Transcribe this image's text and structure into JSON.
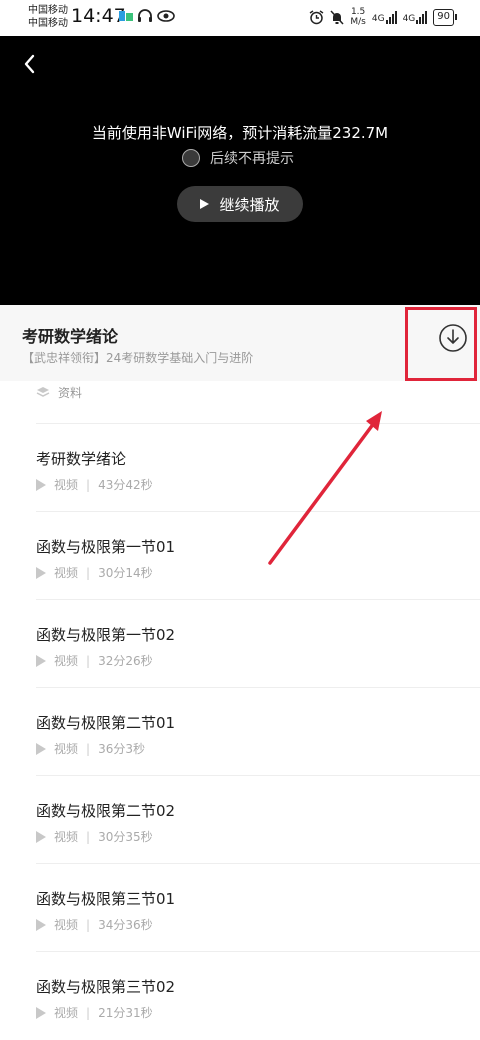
{
  "status_bar": {
    "carrier_1": "中国移动",
    "carrier_2": "中国移动",
    "time": "14:47",
    "speed_value": "1.5",
    "speed_unit": "M/s",
    "net_type_1": "4G",
    "net_type_2": "4G",
    "battery": "90"
  },
  "player": {
    "network_warning": "当前使用非WiFi网络，预计消耗流量232.7M",
    "no_remind_label": "后续不再提示",
    "continue_label": "继续播放"
  },
  "course": {
    "title": "考研数学绪论",
    "subtitle": "【武忠祥领衔】24考研数学基础入门与进阶"
  },
  "materials_label": "资料",
  "lessons": [
    {
      "title": "考研数学绪论",
      "type": "视频",
      "duration": "43分42秒"
    },
    {
      "title": "函数与极限第一节01",
      "type": "视频",
      "duration": "30分14秒"
    },
    {
      "title": "函数与极限第一节02",
      "type": "视频",
      "duration": "32分26秒"
    },
    {
      "title": "函数与极限第二节01",
      "type": "视频",
      "duration": "36分3秒"
    },
    {
      "title": "函数与极限第二节02",
      "type": "视频",
      "duration": "30分35秒"
    },
    {
      "title": "函数与极限第三节01",
      "type": "视频",
      "duration": "34分36秒"
    },
    {
      "title": "函数与极限第三节02",
      "type": "视频",
      "duration": "21分31秒"
    }
  ],
  "meta_separator": "|",
  "colors": {
    "highlight": "#e0253a",
    "player_bg": "#000000",
    "header_bg": "#f7f7f7"
  }
}
